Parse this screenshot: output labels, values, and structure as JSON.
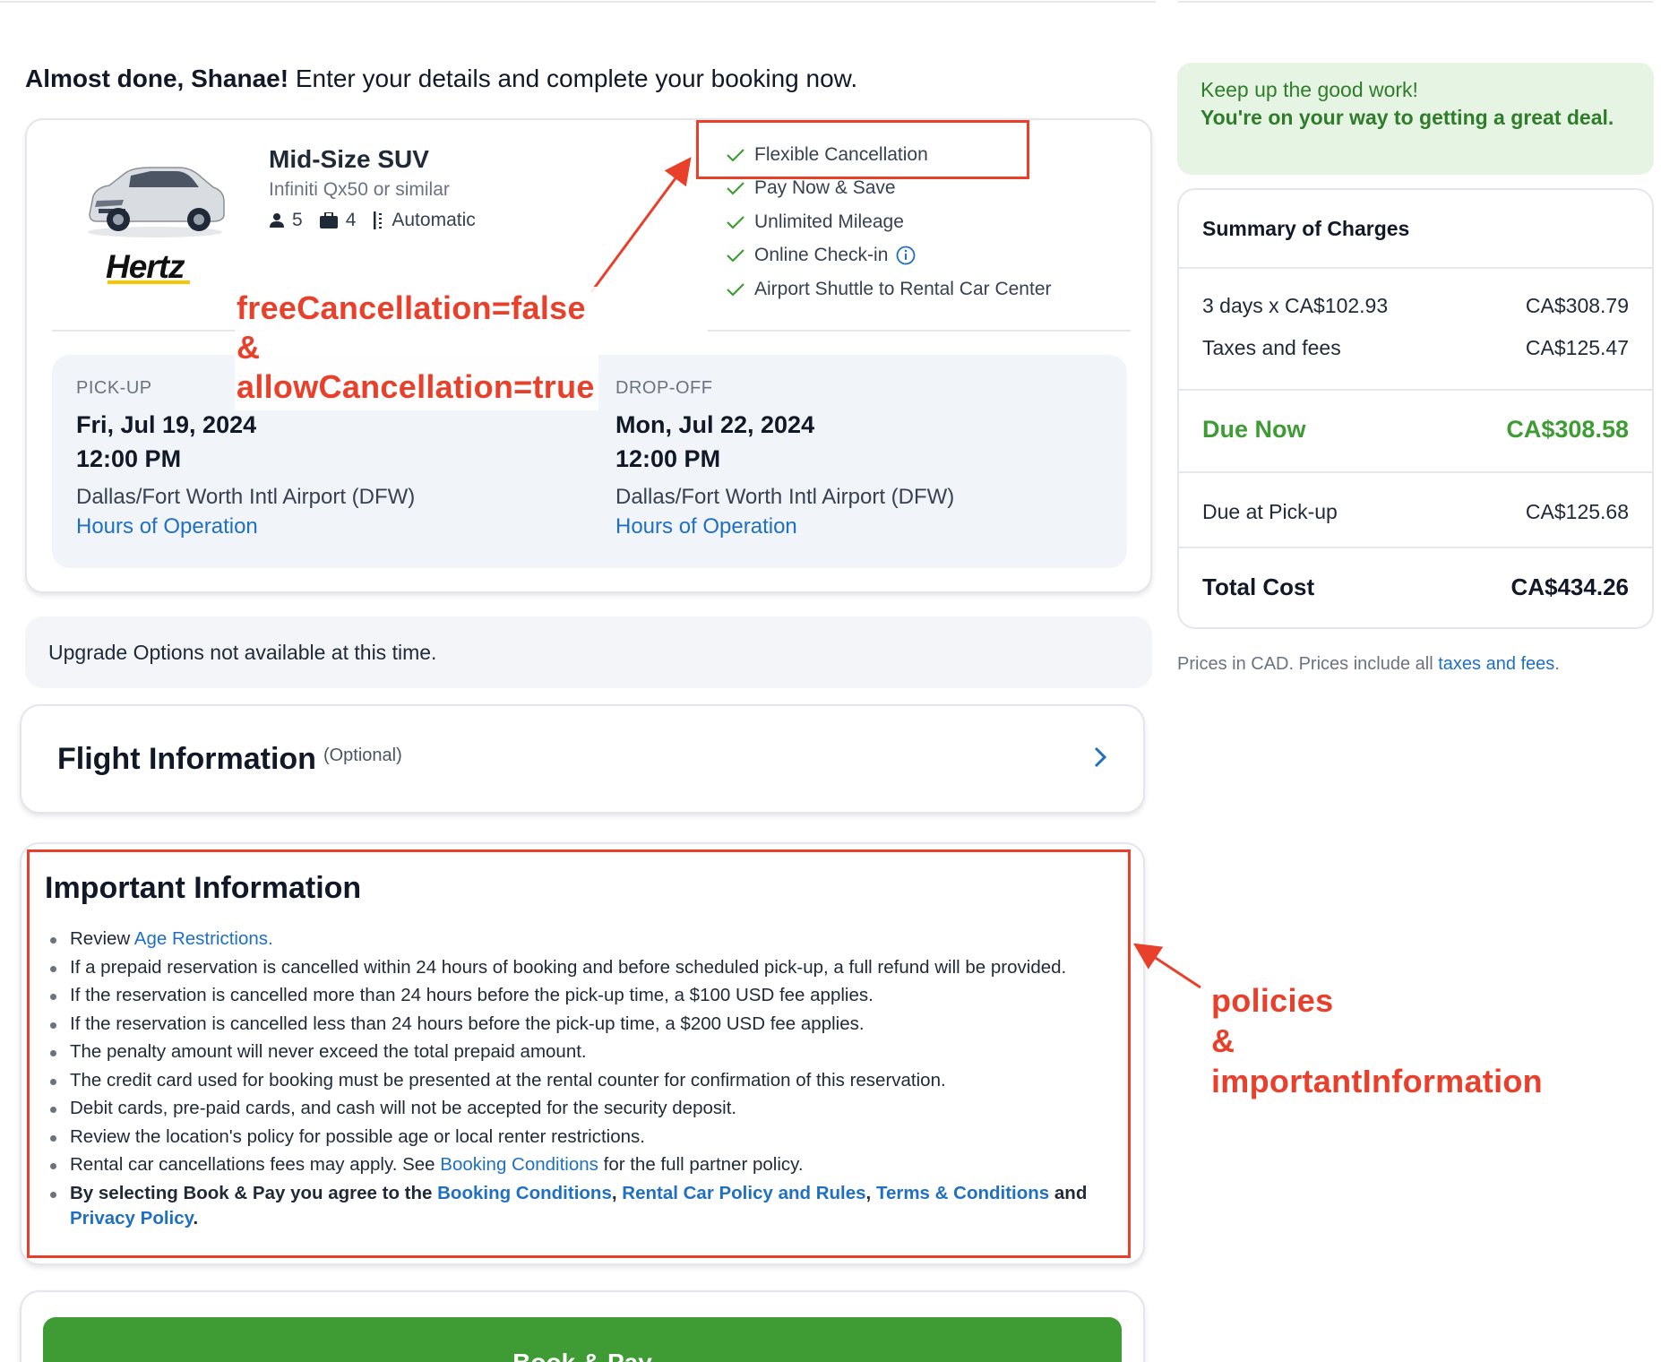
{
  "headline": {
    "greeting": "Almost done, Shanae!",
    "message": " Enter your details and complete your booking now."
  },
  "car": {
    "name": "Mid-Size SUV",
    "similar": "Infiniti Qx50 or similar",
    "brand": "Hertz",
    "passengers": "5",
    "bags": "4",
    "transmission": "Automatic",
    "features": [
      "Flexible Cancellation",
      "Pay Now & Save",
      "Unlimited Mileage",
      "Online Check-in",
      "Airport Shuttle to Rental Car Center"
    ]
  },
  "pickup": {
    "label": "PICK-UP",
    "date": "Fri, Jul 19, 2024",
    "time": "12:00 PM",
    "location": "Dallas/Fort Worth Intl Airport (DFW)",
    "hours_link": "Hours of Operation"
  },
  "dropoff": {
    "label": "DROP-OFF",
    "date": "Mon, Jul 22, 2024",
    "time": "12:00 PM",
    "location": "Dallas/Fort Worth Intl Airport (DFW)",
    "hours_link": "Hours of Operation"
  },
  "upgrade": {
    "text": "Upgrade Options not available at this time."
  },
  "flight": {
    "title": "Flight Information",
    "optional": "(Optional)"
  },
  "important": {
    "title": "Important Information",
    "review_prefix": "Review ",
    "age_link": "Age Restrictions.",
    "items": [
      "If a prepaid reservation is cancelled within 24 hours of booking and before scheduled pick-up, a full refund will be provided.",
      "If the reservation is cancelled more than 24 hours before the pick-up time, a $100 USD fee applies.",
      "If the reservation is cancelled less than 24 hours before the pick-up time, a $200 USD fee applies.",
      "The penalty amount will never exceed the total prepaid amount.",
      "The credit card used for booking must be presented at the rental counter for confirmation of this reservation.",
      "Debit cards, pre-paid cards, and cash will not be accepted for the security deposit.",
      "Review the location's policy for possible age or local renter restrictions."
    ],
    "fees_prefix": "Rental car cancellations fees may apply. See ",
    "fees_link": "Booking Conditions",
    "fees_suffix": " for the full partner policy.",
    "agree_prefix": "By selecting Book & Pay you agree to the ",
    "agree_link1": "Booking Conditions",
    "comma1": ", ",
    "agree_link2": "Rental Car Policy and Rules",
    "comma2": ", ",
    "agree_link3": "Terms & Conditions",
    "and": " and ",
    "agree_link4": "Privacy Policy",
    "period": "."
  },
  "book_button": "Book & Pay",
  "promo": {
    "line1": "Keep up the good work!",
    "line2": "You're on your way to getting a great deal."
  },
  "summary": {
    "title": "Summary of Charges",
    "rows": [
      {
        "label": "3 days x CA$102.93",
        "value": "CA$308.79"
      },
      {
        "label": "Taxes and fees",
        "value": "CA$125.47"
      }
    ],
    "due_now_label": "Due Now",
    "due_now_value": "CA$308.58",
    "due_pickup_label": "Due at Pick-up",
    "due_pickup_value": "CA$125.68",
    "total_label": "Total Cost",
    "total_value": "CA$434.26"
  },
  "prices_note": {
    "text": "Prices in CAD. Prices include all ",
    "link": "taxes and fees",
    "end": "."
  },
  "annotations": {
    "left_line1": "freeCancellation=false",
    "left_line2": "&",
    "left_line3": "allowCancellation=true",
    "right_line1": "policies",
    "right_line2": "&",
    "right_line3": "importantInformation",
    "color": "#e8402a"
  },
  "colors": {
    "accent_green": "#3f9c35",
    "link_blue": "#1f6fc2",
    "promo_bg": "#e6f4e4"
  }
}
